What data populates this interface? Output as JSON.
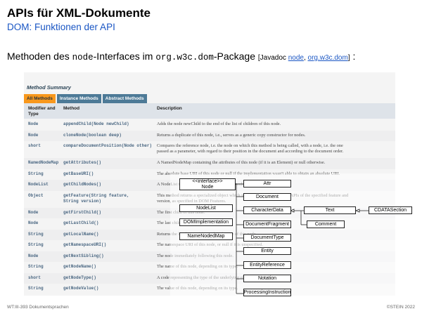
{
  "header": {
    "title": "APIs für XML-Dokumente",
    "subtitle": "DOM: Funktionen der API"
  },
  "headline": {
    "prefix": "Methoden des ",
    "node_code": "node",
    "middle": "-Interfaces im ",
    "package_code": "org.w3c.dom",
    "suffix": "-Package",
    "javadoc_prefix": "[Javadoc ",
    "link_node": "node",
    "sep": ", ",
    "link_package": "org.w3c.dom",
    "javadoc_suffix": "]",
    "colon": " :"
  },
  "javadoc": {
    "section_title": "Method Summary",
    "tabs": [
      "All Methods",
      "Instance Methods",
      "Abstract Methods"
    ],
    "col_modifier": "Modifier and",
    "col_modifier2": "Type",
    "col_method": "Method",
    "col_desc": "Description",
    "rows": [
      {
        "type": "Node",
        "method": "appendChild(Node newChild)",
        "desc": "Adds the node newChild to the end of the list of children of this node."
      },
      {
        "type": "Node",
        "method": "cloneNode(boolean deep)",
        "desc": "Returns a duplicate of this node, i.e., serves as a generic copy constructor for nodes."
      },
      {
        "type": "short",
        "method": "compareDocumentPosition(Node other)",
        "desc": "Compares the reference node, i.e. the node on which this method is being called, with a node, i.e. the one",
        "desc2": "passed as a parameter, with regard to their position in the document and according to the document order."
      },
      {
        "type": "NamedNodeMap",
        "method": "getAttributes()",
        "desc": "A NamedNodeMap containing the attributes of this node (if it is an Element) or null otherwise."
      },
      {
        "type": "String",
        "method": "getBaseURI()",
        "desc": "The absolute base URI of this node or null if the implementation wasn't able to obtain an absolute URI."
      },
      {
        "type": "NodeList",
        "method": "getChildNodes()",
        "desc": "A NodeList that contains all children of this node."
      },
      {
        "type": "Object",
        "method": "getFeature(String feature,",
        "method2": "String version)",
        "desc": "This method returns a specialized object which implements the specialized APIs of the specified feature and",
        "desc2": "version, as specified in DOM Features."
      },
      {
        "type": "Node",
        "method": "getFirstChild()",
        "desc": "The first child of this node."
      },
      {
        "type": "Node",
        "method": "getLastChild()",
        "desc": "The last child of this node."
      },
      {
        "type": "String",
        "method": "getLocalName()",
        "desc": "Returns the local part of the qualified name of this node."
      },
      {
        "type": "String",
        "method": "getNamespaceURI()",
        "desc": "The namespace URI of this node, or null if it is unspecified."
      },
      {
        "type": "Node",
        "method": "getNextSibling()",
        "desc": "The node immediately following this node."
      },
      {
        "type": "String",
        "method": "getNodeName()",
        "desc": "The name of this node, depending on its type."
      },
      {
        "type": "short",
        "method": "getNodeType()",
        "desc": "A code representing the type of the underlying object, as defined above."
      },
      {
        "type": "String",
        "method": "getNodeValue()",
        "desc": "The value of this node, depending on its type."
      }
    ]
  },
  "diagram": {
    "root": "<<interface>>",
    "root2": "Node",
    "left_boxes": [
      "NodeList",
      "DOMImplementation",
      "NameNodedMap"
    ],
    "subclasses": [
      "Attr",
      "Document",
      "CharacterData",
      "DocumentFragment",
      "DocumentType",
      "Entity",
      "EntityReference",
      "Notation",
      "ProcessingInstruction"
    ],
    "text": "Text",
    "comment": "Comment",
    "cdata": "CDATASection"
  },
  "footer": {
    "left": "WT:III-393   Dokumentsprachen",
    "right": "©STEIN 2022"
  }
}
